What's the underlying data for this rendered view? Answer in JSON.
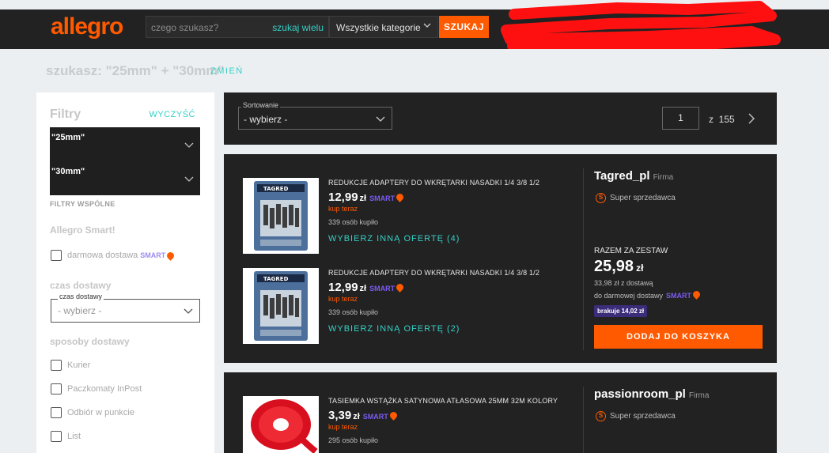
{
  "header": {
    "logo": "allegro",
    "search_placeholder": "czego szukasz?",
    "search_wide": "szukaj wielu",
    "category": "Wszystkie kategorie",
    "search_button": "SZUKAJ"
  },
  "query": {
    "text": "szukasz: \"25mm\" + \"30mm\"",
    "change": "ZMIEŃ"
  },
  "sidebar": {
    "title": "Filtry",
    "clear": "WYCZYŚĆ",
    "chips": [
      "\"25mm\"",
      "\"30mm\""
    ],
    "common_filters": "FILTRY WSPÓLNE",
    "smart_section": "Allegro Smart!",
    "free_delivery": "darmowa dostawa",
    "smart_badge": "SMART",
    "time_section": "czas dostawy",
    "time_label": "czas dostawy",
    "time_value": "- wybierz -",
    "delivery_section": "sposoby dostawy",
    "delivery_options": [
      "Kurier",
      "Paczkomaty InPost",
      "Odbiór w punkcie",
      "List"
    ]
  },
  "sortbar": {
    "label": "Sortowanie",
    "value": "- wybierz -",
    "page": "1",
    "of": "z",
    "total": "155"
  },
  "offers": [
    {
      "title": "REDUKCJE ADAPTERY DO WKRĘTARKI NASADKI 1/4 3/8 1/2",
      "price_main": "12,99",
      "currency": "zł",
      "smart": "SMART",
      "buy_now": "kup teraz",
      "sold": "339 osób kupiło",
      "other": "WYBIERZ INNĄ OFERTĘ (4)"
    },
    {
      "title": "REDUKCJE ADAPTERY DO WKRĘTARKI NASADKI 1/4 3/8 1/2",
      "price_main": "12,99",
      "currency": "zł",
      "smart": "SMART",
      "buy_now": "kup teraz",
      "sold": "339 osób kupiło",
      "other": "WYBIERZ INNĄ OFERTĘ (2)"
    },
    {
      "title": "TASIEMKA WSTĄŻKA SATYNOWA ATŁASOWA 25MM 32M KOLORY",
      "price_main": "3,39",
      "currency": "zł",
      "smart": "SMART",
      "buy_now": "kup teraz",
      "sold": "295 osób kupiło"
    }
  ],
  "sellers": [
    {
      "name": "Tagred_pl",
      "firm": "Firma",
      "super": "Super sprzedawca",
      "set_label": "RAZEM ZA ZESTAW",
      "set_price_main": "25,98",
      "set_currency": "zł",
      "shipping": "33,98 zł z dostawą",
      "free_to": "do darmowej dostawy",
      "smart": "SMART",
      "missing": "brakuje 14,02 zł",
      "cart": "DODAJ DO KOSZYKA"
    },
    {
      "name": "passionroom_pl",
      "firm": "Firma",
      "super": "Super sprzedawca"
    }
  ],
  "thumb_brand": "TAGRED",
  "colors": {
    "accent": "#ff5a00",
    "teal": "#35d0c6",
    "smart": "#7b5bf0",
    "dark": "#222222"
  }
}
